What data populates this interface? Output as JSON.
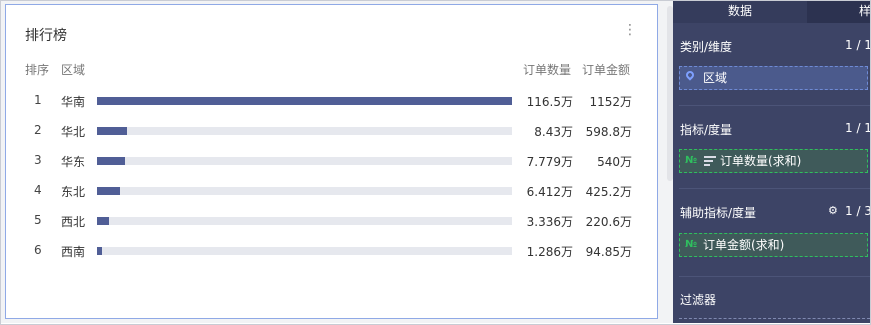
{
  "card": {
    "title": "排行榜",
    "more_icon": "⋮",
    "headers": {
      "rank": "排序",
      "region": "区域",
      "qty": "订单数量",
      "amt": "订单金额"
    },
    "rows": [
      {
        "rank": "1",
        "region": "华南",
        "qty": "116.5万",
        "amt": "1152万",
        "fraction": 1.0
      },
      {
        "rank": "2",
        "region": "华北",
        "qty": "8.43万",
        "amt": "598.8万",
        "fraction": 0.0724
      },
      {
        "rank": "3",
        "region": "华东",
        "qty": "7.779万",
        "amt": "540万",
        "fraction": 0.0668
      },
      {
        "rank": "4",
        "region": "东北",
        "qty": "6.412万",
        "amt": "425.2万",
        "fraction": 0.055
      },
      {
        "rank": "5",
        "region": "西北",
        "qty": "3.336万",
        "amt": "220.6万",
        "fraction": 0.0286
      },
      {
        "rank": "6",
        "region": "西南",
        "qty": "1.286万",
        "amt": "94.85万",
        "fraction": 0.011
      }
    ],
    "bar_color": "#505e96"
  },
  "panel": {
    "tab_data": "数据",
    "tab_style": "样",
    "dimension": {
      "title": "类别/维度",
      "count": "1 / 1",
      "field": "区域",
      "icon": "location-pin-icon"
    },
    "measure": {
      "title": "指标/度量",
      "count": "1 / 1",
      "field": "订单数量(求和)",
      "icon": "number-icon",
      "sort_icon": "sort-icon",
      "no_text": "№"
    },
    "aux_measure": {
      "title": "辅助指标/度量",
      "count": "1 / 3",
      "field": "订单金额(求和)",
      "icon": "number-icon",
      "no_text": "№",
      "gear": "⚙"
    },
    "filter": {
      "title": "过滤器"
    }
  }
}
